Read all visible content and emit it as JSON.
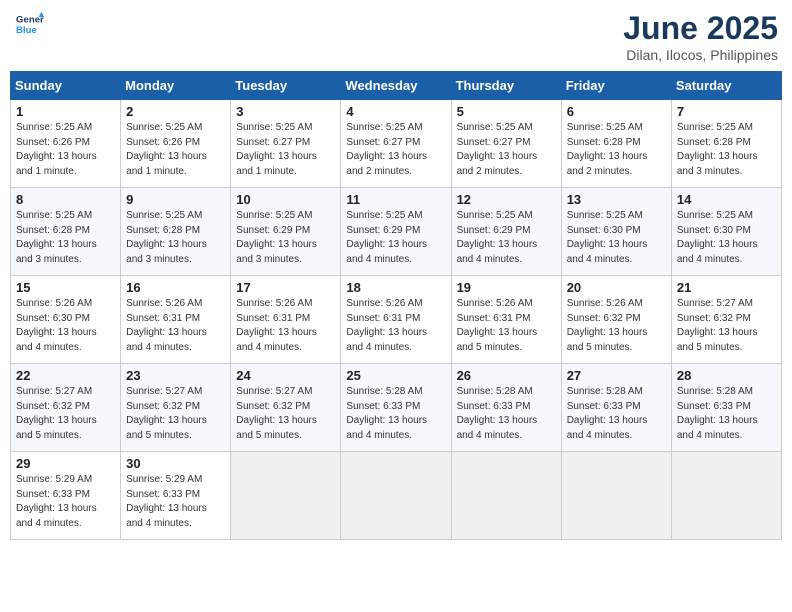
{
  "header": {
    "logo_general": "General",
    "logo_blue": "Blue",
    "month": "June 2025",
    "location": "Dilan, Ilocos, Philippines"
  },
  "days_of_week": [
    "Sunday",
    "Monday",
    "Tuesday",
    "Wednesday",
    "Thursday",
    "Friday",
    "Saturday"
  ],
  "weeks": [
    [
      {
        "day": "1",
        "info": "Sunrise: 5:25 AM\nSunset: 6:26 PM\nDaylight: 13 hours\nand 1 minute."
      },
      {
        "day": "2",
        "info": "Sunrise: 5:25 AM\nSunset: 6:26 PM\nDaylight: 13 hours\nand 1 minute."
      },
      {
        "day": "3",
        "info": "Sunrise: 5:25 AM\nSunset: 6:27 PM\nDaylight: 13 hours\nand 1 minute."
      },
      {
        "day": "4",
        "info": "Sunrise: 5:25 AM\nSunset: 6:27 PM\nDaylight: 13 hours\nand 2 minutes."
      },
      {
        "day": "5",
        "info": "Sunrise: 5:25 AM\nSunset: 6:27 PM\nDaylight: 13 hours\nand 2 minutes."
      },
      {
        "day": "6",
        "info": "Sunrise: 5:25 AM\nSunset: 6:28 PM\nDaylight: 13 hours\nand 2 minutes."
      },
      {
        "day": "7",
        "info": "Sunrise: 5:25 AM\nSunset: 6:28 PM\nDaylight: 13 hours\nand 3 minutes."
      }
    ],
    [
      {
        "day": "8",
        "info": "Sunrise: 5:25 AM\nSunset: 6:28 PM\nDaylight: 13 hours\nand 3 minutes."
      },
      {
        "day": "9",
        "info": "Sunrise: 5:25 AM\nSunset: 6:28 PM\nDaylight: 13 hours\nand 3 minutes."
      },
      {
        "day": "10",
        "info": "Sunrise: 5:25 AM\nSunset: 6:29 PM\nDaylight: 13 hours\nand 3 minutes."
      },
      {
        "day": "11",
        "info": "Sunrise: 5:25 AM\nSunset: 6:29 PM\nDaylight: 13 hours\nand 4 minutes."
      },
      {
        "day": "12",
        "info": "Sunrise: 5:25 AM\nSunset: 6:29 PM\nDaylight: 13 hours\nand 4 minutes."
      },
      {
        "day": "13",
        "info": "Sunrise: 5:25 AM\nSunset: 6:30 PM\nDaylight: 13 hours\nand 4 minutes."
      },
      {
        "day": "14",
        "info": "Sunrise: 5:25 AM\nSunset: 6:30 PM\nDaylight: 13 hours\nand 4 minutes."
      }
    ],
    [
      {
        "day": "15",
        "info": "Sunrise: 5:26 AM\nSunset: 6:30 PM\nDaylight: 13 hours\nand 4 minutes."
      },
      {
        "day": "16",
        "info": "Sunrise: 5:26 AM\nSunset: 6:31 PM\nDaylight: 13 hours\nand 4 minutes."
      },
      {
        "day": "17",
        "info": "Sunrise: 5:26 AM\nSunset: 6:31 PM\nDaylight: 13 hours\nand 4 minutes."
      },
      {
        "day": "18",
        "info": "Sunrise: 5:26 AM\nSunset: 6:31 PM\nDaylight: 13 hours\nand 4 minutes."
      },
      {
        "day": "19",
        "info": "Sunrise: 5:26 AM\nSunset: 6:31 PM\nDaylight: 13 hours\nand 5 minutes."
      },
      {
        "day": "20",
        "info": "Sunrise: 5:26 AM\nSunset: 6:32 PM\nDaylight: 13 hours\nand 5 minutes."
      },
      {
        "day": "21",
        "info": "Sunrise: 5:27 AM\nSunset: 6:32 PM\nDaylight: 13 hours\nand 5 minutes."
      }
    ],
    [
      {
        "day": "22",
        "info": "Sunrise: 5:27 AM\nSunset: 6:32 PM\nDaylight: 13 hours\nand 5 minutes."
      },
      {
        "day": "23",
        "info": "Sunrise: 5:27 AM\nSunset: 6:32 PM\nDaylight: 13 hours\nand 5 minutes."
      },
      {
        "day": "24",
        "info": "Sunrise: 5:27 AM\nSunset: 6:32 PM\nDaylight: 13 hours\nand 5 minutes."
      },
      {
        "day": "25",
        "info": "Sunrise: 5:28 AM\nSunset: 6:33 PM\nDaylight: 13 hours\nand 4 minutes."
      },
      {
        "day": "26",
        "info": "Sunrise: 5:28 AM\nSunset: 6:33 PM\nDaylight: 13 hours\nand 4 minutes."
      },
      {
        "day": "27",
        "info": "Sunrise: 5:28 AM\nSunset: 6:33 PM\nDaylight: 13 hours\nand 4 minutes."
      },
      {
        "day": "28",
        "info": "Sunrise: 5:28 AM\nSunset: 6:33 PM\nDaylight: 13 hours\nand 4 minutes."
      }
    ],
    [
      {
        "day": "29",
        "info": "Sunrise: 5:29 AM\nSunset: 6:33 PM\nDaylight: 13 hours\nand 4 minutes."
      },
      {
        "day": "30",
        "info": "Sunrise: 5:29 AM\nSunset: 6:33 PM\nDaylight: 13 hours\nand 4 minutes."
      },
      {
        "day": "",
        "info": ""
      },
      {
        "day": "",
        "info": ""
      },
      {
        "day": "",
        "info": ""
      },
      {
        "day": "",
        "info": ""
      },
      {
        "day": "",
        "info": ""
      }
    ]
  ]
}
